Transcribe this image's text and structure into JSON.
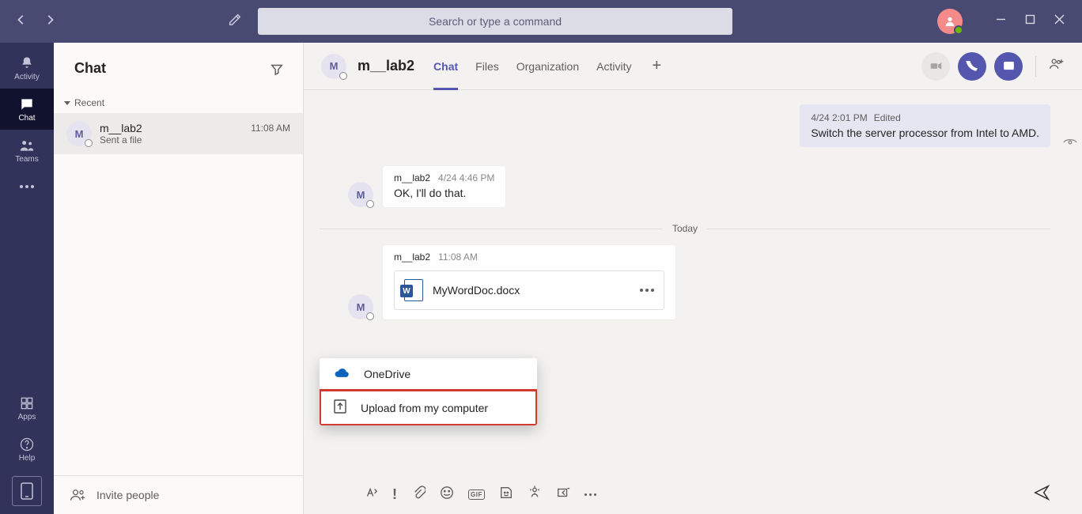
{
  "search_placeholder": "Search or type a command",
  "rail": {
    "activity": "Activity",
    "chat": "Chat",
    "teams": "Teams",
    "apps": "Apps",
    "help": "Help"
  },
  "chatlist": {
    "title": "Chat",
    "section": "Recent",
    "item": {
      "initial": "M",
      "name": "m__lab2",
      "subtitle": "Sent a file",
      "time": "11:08 AM"
    },
    "invite": "Invite people"
  },
  "mainhead": {
    "initial": "M",
    "name": "m__lab2",
    "tabs": {
      "chat": "Chat",
      "files": "Files",
      "org": "Organization",
      "activity": "Activity"
    }
  },
  "msgs": {
    "out": {
      "time": "4/24 2:01 PM",
      "edited": "Edited",
      "text": "Switch the server processor from Intel to AMD."
    },
    "in1": {
      "initial": "M",
      "name": "m__lab2",
      "time": "4/24 4:46 PM",
      "text": "OK, I'll do that."
    },
    "today": "Today",
    "file": {
      "initial": "M",
      "name": "m__lab2",
      "time": "11:08 AM",
      "filename": "MyWordDoc.docx"
    }
  },
  "popup": {
    "onedrive": "OneDrive",
    "upload": "Upload from my computer"
  },
  "compose": {
    "gif": "GIF"
  }
}
